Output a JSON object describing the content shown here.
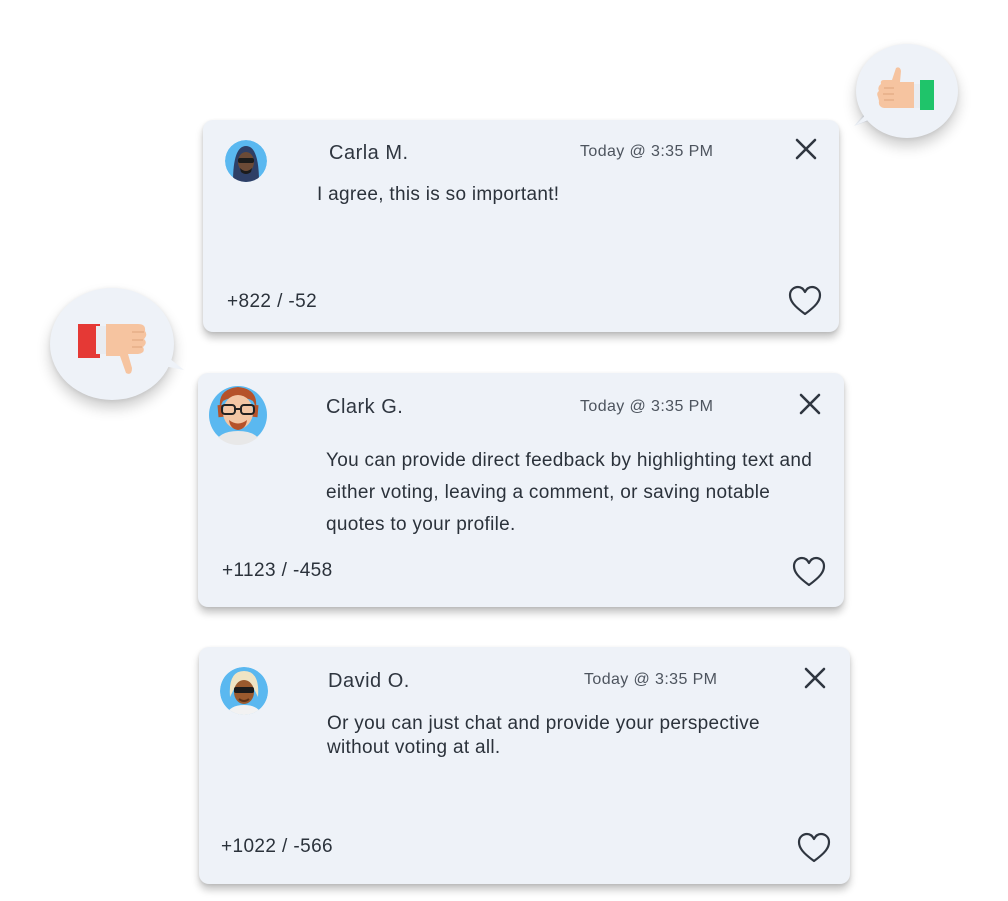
{
  "comments": [
    {
      "author": "Carla M.",
      "timestamp": "Today @ 3:35 PM",
      "message": "I agree, this is so important!",
      "votes": "+822 / -52"
    },
    {
      "author": "Clark G.",
      "timestamp": "Today @ 3:35 PM",
      "message": "You can provide direct feedback by highlighting text and either voting, leaving a comment, or saving notable quotes to your profile.",
      "votes": "+1123 / -458"
    },
    {
      "author": "David O.",
      "timestamp": "Today @ 3:35 PM",
      "message": "Or you can just chat and provide your perspective without voting at all.",
      "votes": "+1022 / -566"
    }
  ],
  "icons": {
    "upvote": "thumbs-up-icon",
    "downvote": "thumbs-down-icon",
    "close": "close-icon",
    "like": "heart-icon"
  },
  "colors": {
    "card_bg": "#eef2f8",
    "text": "#2b323b",
    "thumb_up_cuff": "#1fc46a",
    "thumb_down_cuff": "#e53935",
    "skin": "#f6c4a0",
    "avatar_bg": "#5ab8f0"
  }
}
